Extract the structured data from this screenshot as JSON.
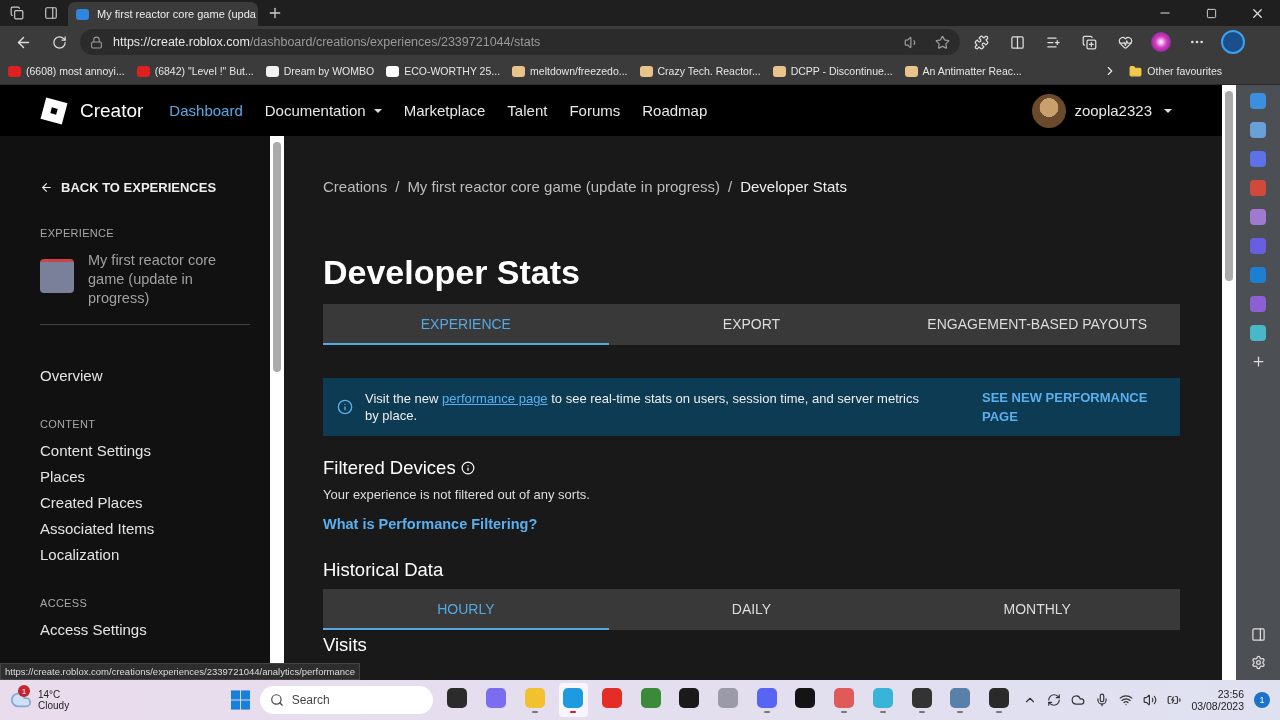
{
  "browser": {
    "tab_title": "My first reactor core game (upda",
    "url_host": "https://create.roblox.com",
    "url_path": "/dashboard/creations/experiences/2339721044/stats",
    "bookmarks": [
      {
        "kind": "video",
        "label": "(6608) most annoyi..."
      },
      {
        "kind": "video",
        "label": "(6842) \"Level !\" But..."
      },
      {
        "kind": "art",
        "label": "Dream by WOMBO"
      },
      {
        "kind": "shop",
        "label": "ECO-WORTHY 25..."
      },
      {
        "kind": "doc",
        "label": "meltdown/freezedo..."
      },
      {
        "kind": "doc",
        "label": "Crazy Tech. Reactor..."
      },
      {
        "kind": "doc",
        "label": "DCPP - Discontinue..."
      },
      {
        "kind": "doc",
        "label": "An Antimatter Reac..."
      }
    ],
    "other_favourites": "Other favourites",
    "status_url": "https://create.roblox.com/creations/experiences/2339721044/analytics/performance"
  },
  "topnav": {
    "brand": "Creator",
    "links": [
      {
        "label": "Dashboard",
        "selected": true,
        "dropdown": false
      },
      {
        "label": "Documentation",
        "selected": false,
        "dropdown": true
      },
      {
        "label": "Marketplace",
        "selected": false,
        "dropdown": false
      },
      {
        "label": "Talent",
        "selected": false,
        "dropdown": false
      },
      {
        "label": "Forums",
        "selected": false,
        "dropdown": false
      },
      {
        "label": "Roadmap",
        "selected": false,
        "dropdown": false
      }
    ],
    "username": "zoopla2323"
  },
  "sidebar": {
    "back": "BACK TO EXPERIENCES",
    "experience_heading": "EXPERIENCE",
    "experience_name": "My first reactor core game (update in progress)",
    "sections": [
      {
        "items": [
          "Overview"
        ]
      },
      {
        "heading": "CONTENT",
        "items": [
          "Content Settings",
          "Places",
          "Created Places",
          "Associated Items",
          "Localization"
        ]
      },
      {
        "heading": "ACCESS",
        "items": [
          "Access Settings"
        ]
      }
    ]
  },
  "main": {
    "breadcrumb_separator": "/",
    "breadcrumbs": [
      "Creations",
      "My first reactor core game (update in progress)",
      "Developer Stats"
    ],
    "title": "Developer Stats",
    "tabs": [
      {
        "label": "EXPERIENCE",
        "selected": true
      },
      {
        "label": "EXPORT",
        "selected": false
      },
      {
        "label": "ENGAGEMENT-BASED PAYOUTS",
        "selected": false
      }
    ],
    "banner": {
      "before": "Visit the new ",
      "link": "performance page",
      "after": " to see real-time stats on users, session time, and server metrics by place.",
      "button": "SEE NEW PERFORMANCE PAGE"
    },
    "filtered": {
      "title": "Filtered Devices",
      "text": "Your experience is not filtered out of any sorts.",
      "link": "What is Performance Filtering?"
    },
    "historical": {
      "title": "Historical Data",
      "tabs": [
        {
          "label": "HOURLY",
          "selected": true
        },
        {
          "label": "DAILY",
          "selected": false
        },
        {
          "label": "MONTHLY",
          "selected": false
        }
      ]
    },
    "next_heading": "Visits"
  },
  "taskbar": {
    "weather_badge": "1",
    "temperature": "14°C",
    "condition": "Cloudy",
    "search": "Search",
    "apps": [
      {
        "color": "#2b2b2b",
        "running": false,
        "selected": false
      },
      {
        "color": "#7b6cf0",
        "running": false,
        "selected": false
      },
      {
        "color": "#f2c12e",
        "running": true,
        "selected": false
      },
      {
        "color": "#1e9be0",
        "running": true,
        "selected": true
      },
      {
        "color": "#e52d27",
        "running": false,
        "selected": false
      },
      {
        "color": "#3a8a3a",
        "running": false,
        "selected": false
      },
      {
        "color": "#1a1a1a",
        "running": false,
        "selected": false
      },
      {
        "color": "#9a9aa8",
        "running": false,
        "selected": false
      },
      {
        "color": "#5865f2",
        "running": true,
        "selected": false
      },
      {
        "color": "#141414",
        "running": false,
        "selected": false
      },
      {
        "color": "#e05a5a",
        "running": true,
        "selected": false
      },
      {
        "color": "#37b4d8",
        "running": true,
        "selected": false
      },
      {
        "color": "#333333",
        "running": true,
        "selected": false
      },
      {
        "color": "#5a7fa8",
        "running": true,
        "selected": false
      },
      {
        "color": "#2a2a2a",
        "running": true,
        "selected": false
      }
    ],
    "time": "23:56",
    "date": "03/08/2023",
    "notifications": "1"
  },
  "edge_sidebar": [
    {
      "color": "#3b8fe0"
    },
    {
      "color": "#6aa0d8"
    },
    {
      "color": "#5c72e8"
    },
    {
      "color": "#d0493b"
    },
    {
      "color": "#a07ad0"
    },
    {
      "color": "#6a5ee0"
    },
    {
      "color": "#1c7fd1"
    },
    {
      "color": "#8d5fd3"
    },
    {
      "color": "#48b8c8"
    }
  ]
}
